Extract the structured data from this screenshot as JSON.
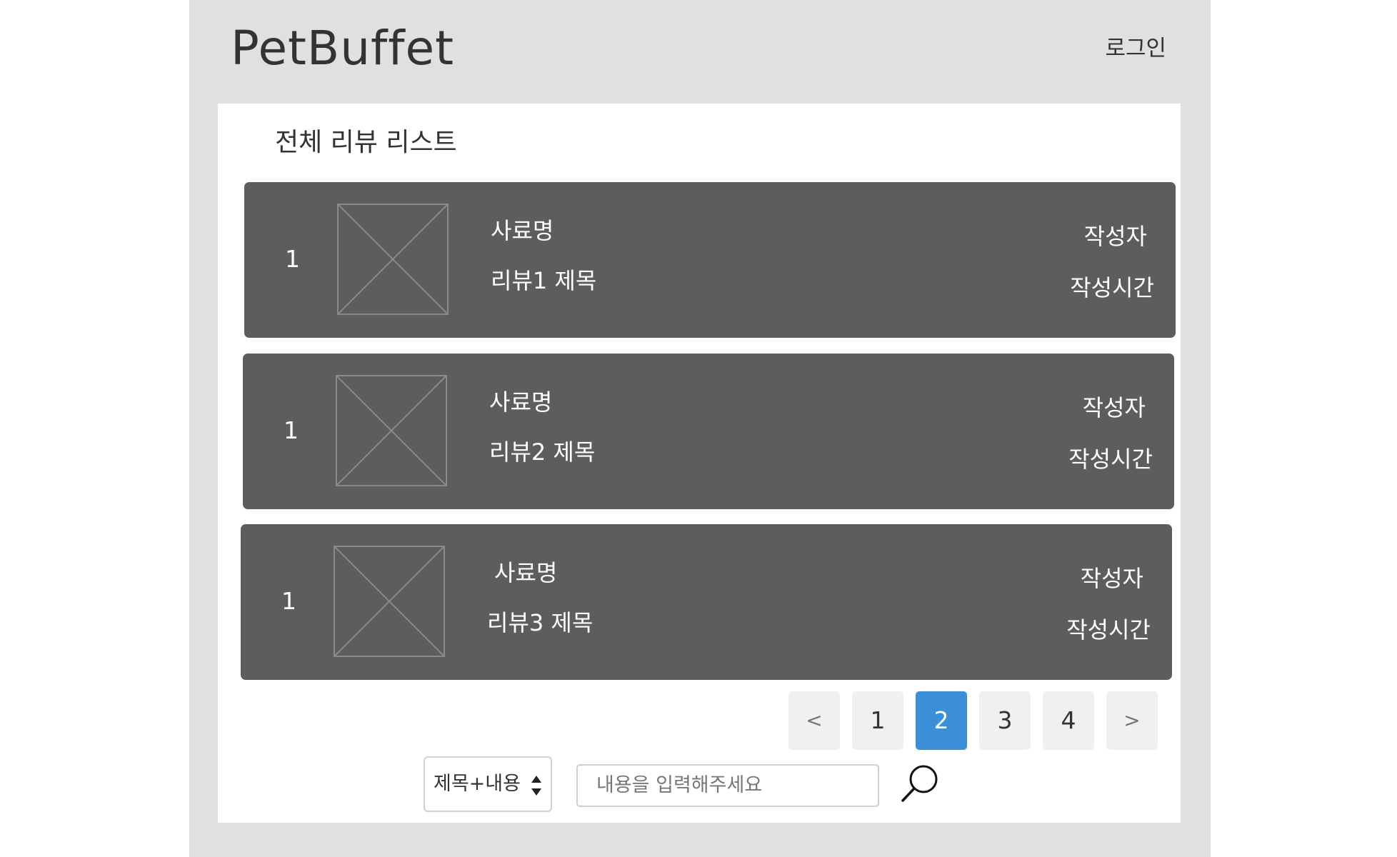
{
  "header": {
    "logo": "PetBuffet",
    "login_label": "로그인"
  },
  "main": {
    "title": "전체 리뷰 리스트",
    "reviews": [
      {
        "number": "1",
        "food_name": "사료명",
        "review_title": "리뷰1 제목",
        "author": "작성자",
        "time": "작성시간"
      },
      {
        "number": "1",
        "food_name": "사료명",
        "review_title": "리뷰2 제목",
        "author": "작성자",
        "time": "작성시간"
      },
      {
        "number": "1",
        "food_name": "사료명",
        "review_title": "리뷰3 제목",
        "author": "작성자",
        "time": "작성시간"
      }
    ]
  },
  "pagination": {
    "prev_label": "<",
    "next_label": ">",
    "pages": [
      "1",
      "2",
      "3",
      "4"
    ],
    "current_page": "2"
  },
  "search": {
    "filter_selected": "제목+내용",
    "placeholder": "내용을 입력해주세요"
  },
  "colors": {
    "card_background": "#5d5d5d",
    "active_page": "#3a8fd8",
    "frame_background": "#e0e0e0"
  }
}
